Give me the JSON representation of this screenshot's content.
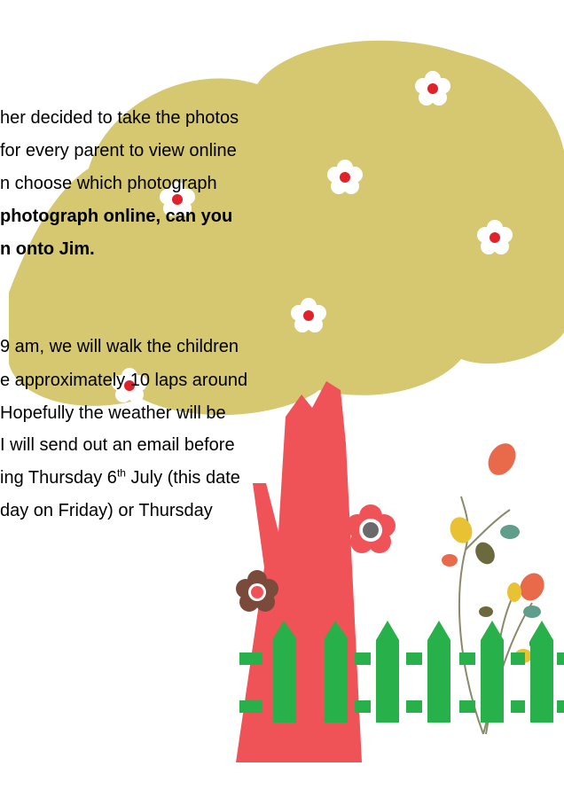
{
  "colors": {
    "canopy": "#d5c870",
    "trunk": "#ef5257",
    "fence": "#28b04a",
    "flower_petal": "#ffffff",
    "flower_center": "#e0232a",
    "brown_flower": "#7a4a3a",
    "orange": "#e86a4a",
    "yellow": "#e8c233",
    "teal": "#5f9e8a",
    "olive": "#6b6a3e",
    "stem": "#8a8a6a"
  },
  "paragraph1": {
    "line1": "her decided to take the photos",
    "line2": "for every parent to view online",
    "line3": "n choose which photograph",
    "line4": "photograph online, can you",
    "line5": "n onto Jim."
  },
  "paragraph2": {
    "line1": " 9 am, we will walk the children",
    "line2": "e approximately 10 laps around",
    "line3": "Hopefully the weather will be",
    "line4": "I will send out an email before",
    "line5_pre": "ing Thursday 6",
    "line5_sup": "th",
    "line5_post": " July (this date",
    "line6": "day on Friday) or Thursday"
  }
}
